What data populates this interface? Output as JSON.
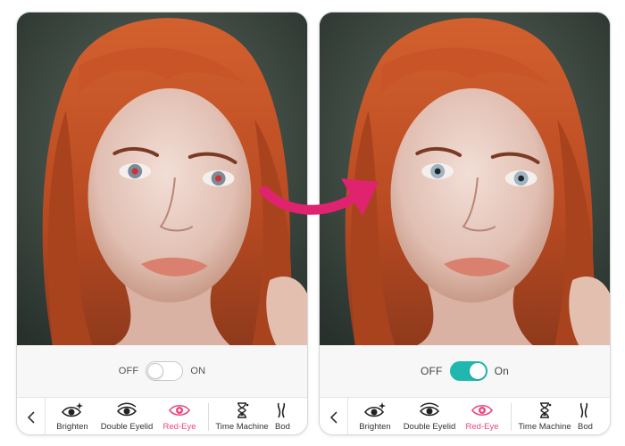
{
  "before": {
    "toggle": {
      "off_label": "OFF",
      "on_label": "ON",
      "state": "off"
    }
  },
  "after": {
    "toggle": {
      "off_label": "OFF",
      "on_label": "On",
      "state": "on"
    }
  },
  "toolbar": {
    "back_icon": "chevron-left-icon",
    "tools": [
      {
        "label": "Brighten",
        "icon": "eye-sparkle-icon"
      },
      {
        "label": "Double Eyelid",
        "icon": "eye-icon"
      },
      {
        "label": "Red-Eye",
        "icon": "red-eye-icon",
        "active": true
      },
      {
        "label": "Time Machine",
        "icon": "hourglass-icon"
      },
      {
        "label": "Bod",
        "icon": "body-icon"
      }
    ]
  },
  "colors": {
    "accent_pink": "#e8477f",
    "arrow_magenta": "#e0236e",
    "toggle_on": "#20b7ae",
    "hair": "#c2502a",
    "iris_before": "#7b8c98",
    "iris_after": "#9fb3c2",
    "red_pupil": "#d0303a"
  },
  "arrow_icon": "curved-right-arrow-icon"
}
